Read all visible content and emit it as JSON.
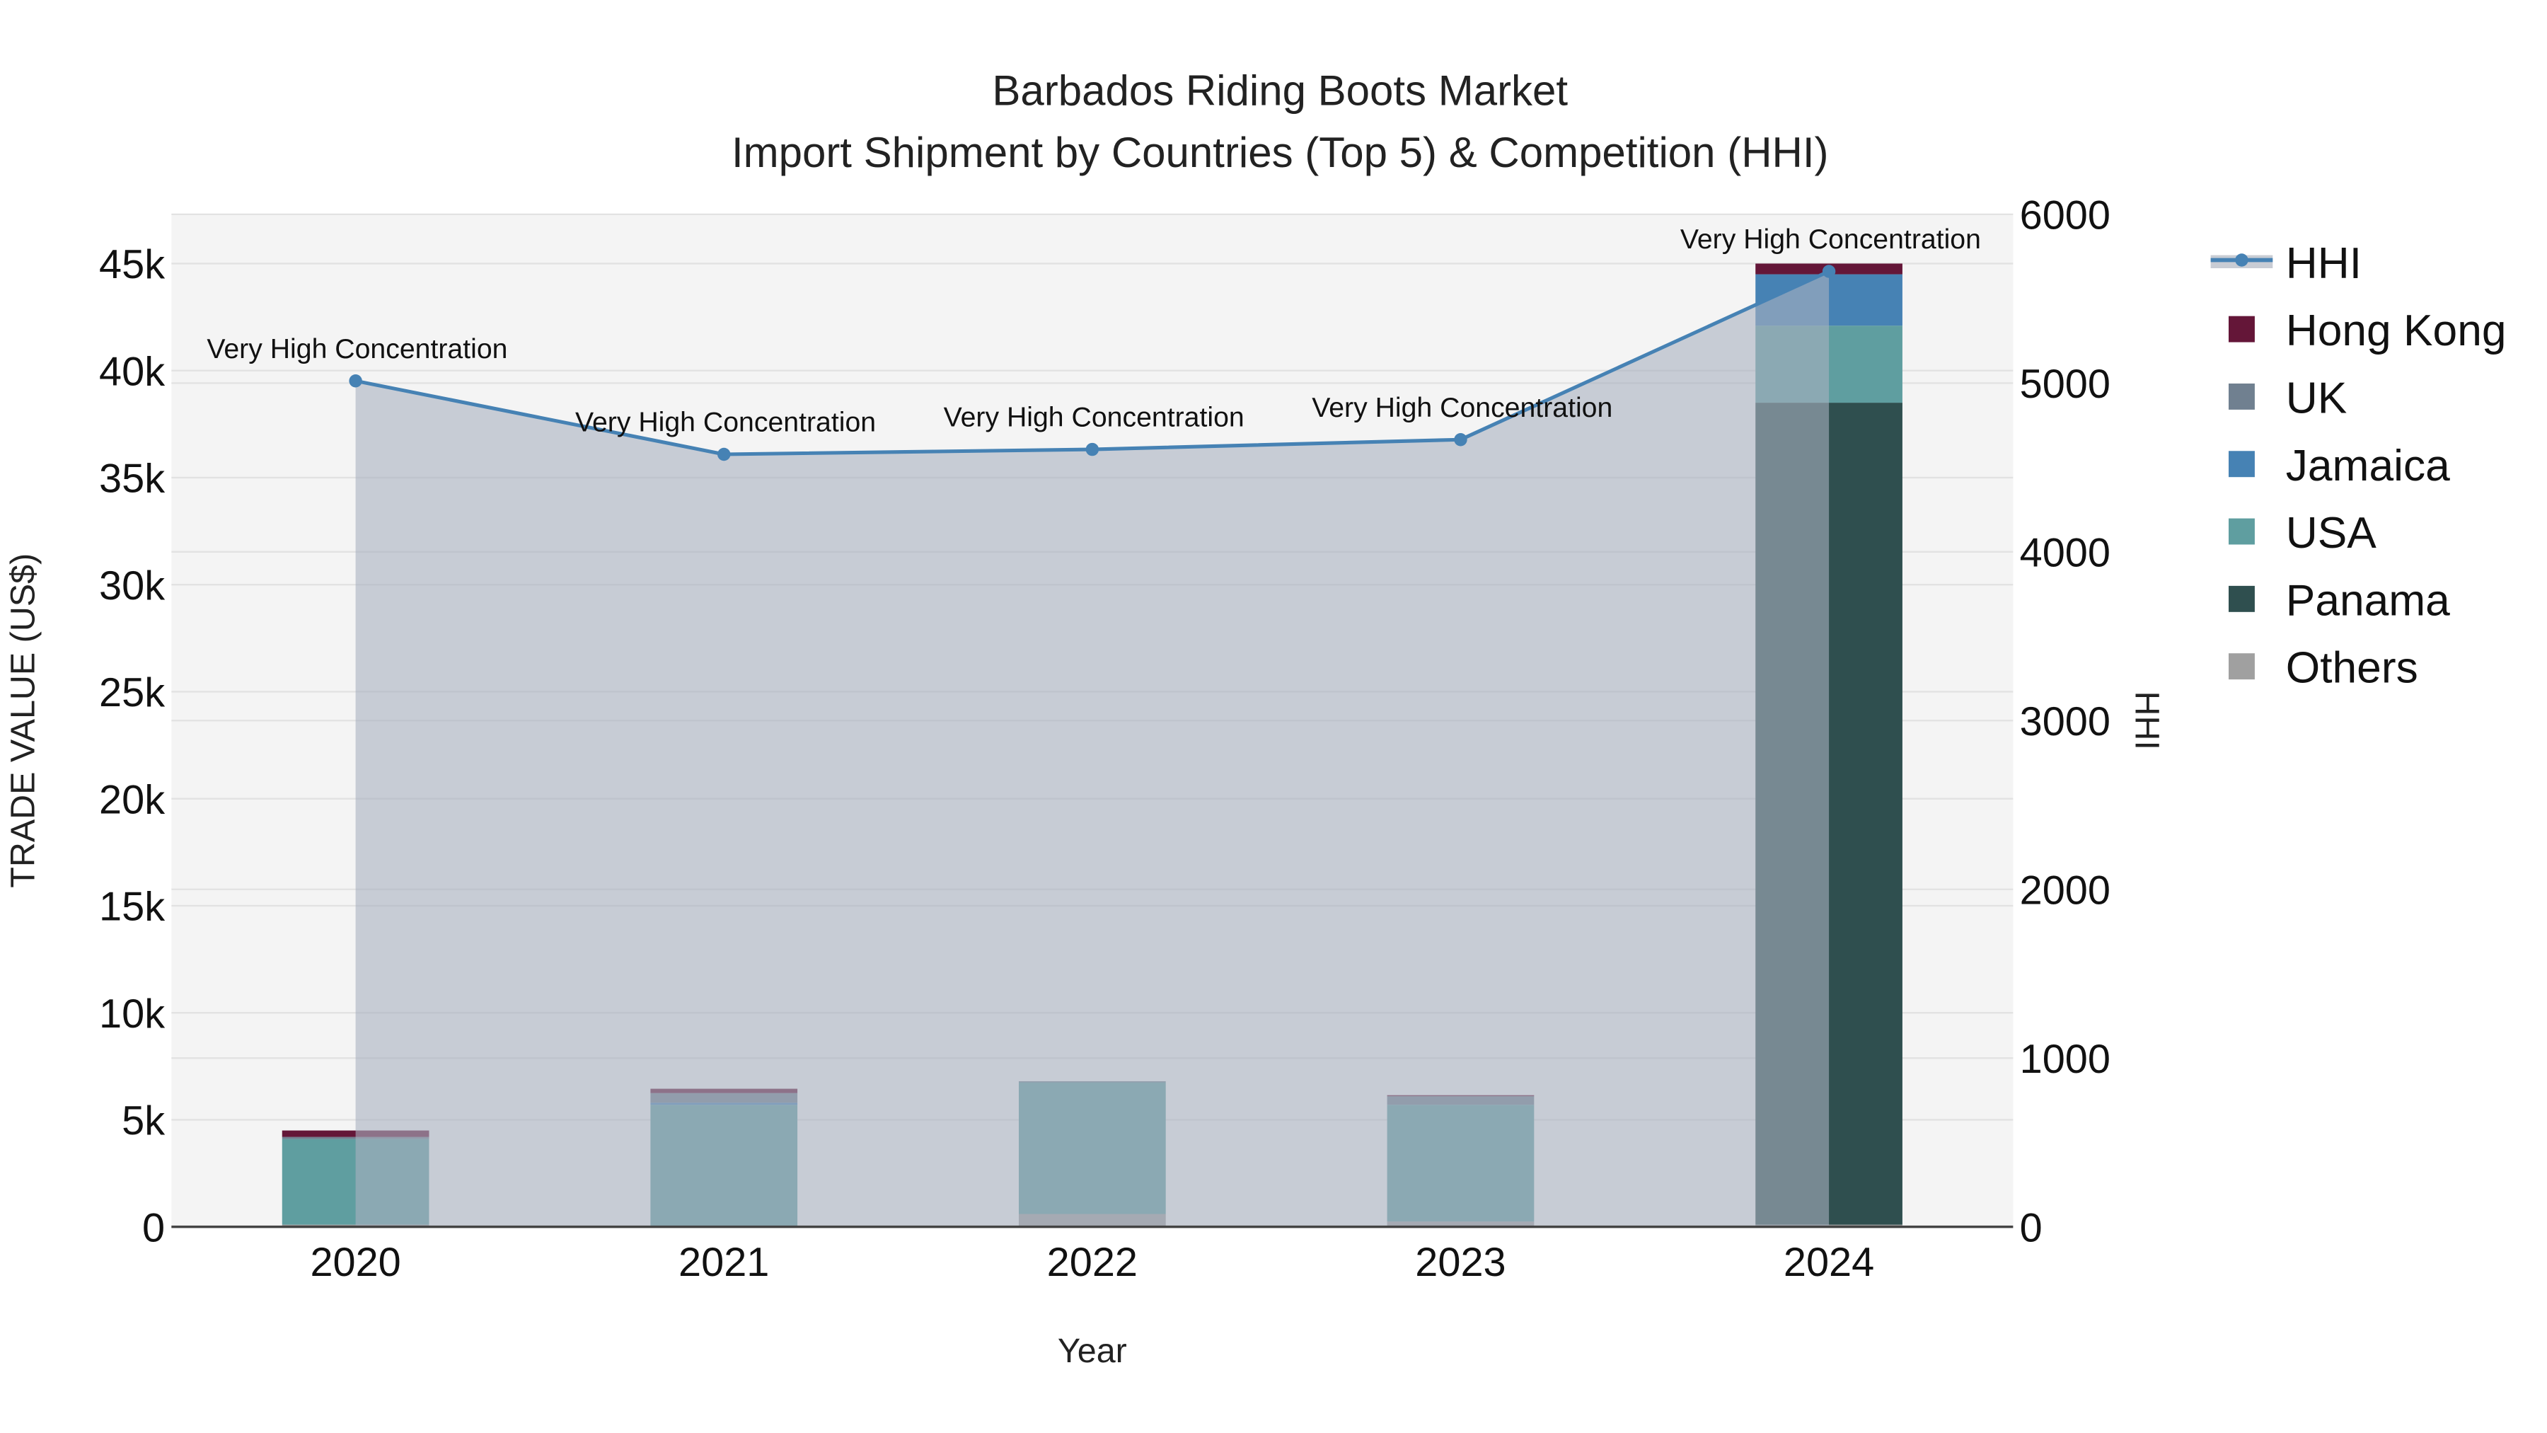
{
  "chart_data": {
    "type": "bar",
    "title_line1": "Barbados Riding Boots Market",
    "title_line2": "Import Shipment by Countries (Top 5) & Competition (HHI)",
    "xlabel": "Year",
    "ylabel": "TRADE VALUE (US$)",
    "y2label": "HHI",
    "categories": [
      "2020",
      "2021",
      "2022",
      "2023",
      "2024"
    ],
    "ylim": [
      0,
      47300
    ],
    "y_ticks": [
      0,
      5000,
      10000,
      15000,
      20000,
      25000,
      30000,
      35000,
      40000,
      45000
    ],
    "y_tick_labels": [
      "0",
      "5k",
      "10k",
      "15k",
      "20k",
      "25k",
      "30k",
      "35k",
      "40k",
      "45k"
    ],
    "y2lim": [
      0,
      6000
    ],
    "y2_ticks": [
      0,
      1000,
      2000,
      3000,
      4000,
      5000,
      6000
    ],
    "y2_tick_labels": [
      "0",
      "1000",
      "2000",
      "3000",
      "4000",
      "5000",
      "6000"
    ],
    "series": [
      {
        "name": "Others",
        "color": "#a0a0a0",
        "values": [
          100,
          30,
          600,
          250,
          100
        ]
      },
      {
        "name": "Panama",
        "color": "#2f4f4f",
        "values": [
          0,
          0,
          0,
          0,
          38400
        ]
      },
      {
        "name": "USA",
        "color": "#5f9ea0",
        "values": [
          4000,
          5670,
          6150,
          5450,
          3600
        ]
      },
      {
        "name": "Jamaica",
        "color": "#4682b4",
        "values": [
          0,
          100,
          0,
          0,
          2400
        ]
      },
      {
        "name": "UK",
        "color": "#708090",
        "values": [
          100,
          450,
          50,
          400,
          0
        ]
      },
      {
        "name": "Hong Kong",
        "color": "#641638",
        "values": [
          300,
          200,
          0,
          50,
          500
        ]
      }
    ],
    "hhi": {
      "name": "HHI",
      "color": "#4682b4",
      "values": [
        5013,
        4578,
        4607,
        4665,
        5662
      ],
      "annotations": [
        "Very High Concentration",
        "Very High Concentration",
        "Very High Concentration",
        "Very High Concentration",
        "Very High Concentration"
      ]
    },
    "legend": [
      "HHI",
      "Hong Kong",
      "UK",
      "Jamaica",
      "USA",
      "Panama",
      "Others"
    ],
    "legend_placement": "right",
    "grid": true
  }
}
